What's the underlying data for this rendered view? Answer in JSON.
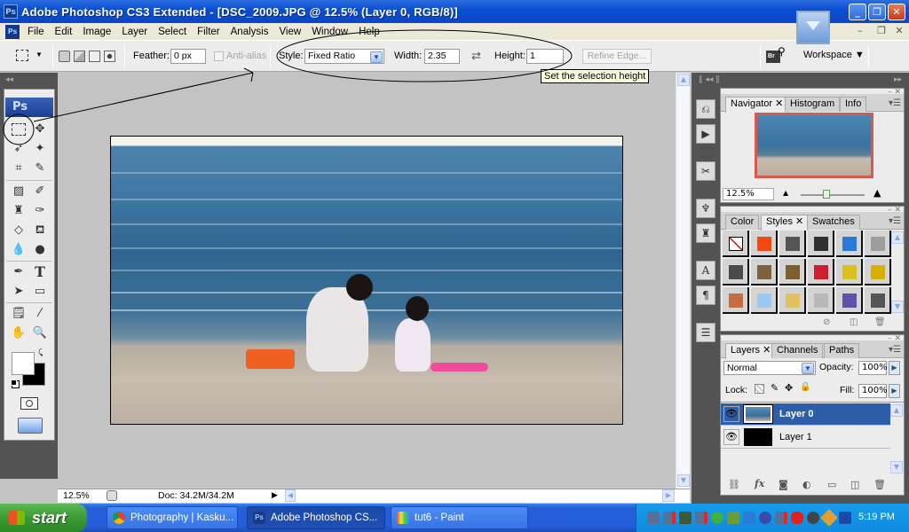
{
  "window": {
    "title": "Adobe Photoshop CS3 Extended - [DSC_2009.JPG @ 12.5% (Layer 0, RGB/8)]",
    "app_icon": "Ps",
    "controls": {
      "minimize": "_",
      "maximize": "❐",
      "close": "✕"
    },
    "doc_controls": {
      "minimize": "–",
      "restore": "❐",
      "close": "✕"
    }
  },
  "menu": [
    "File",
    "Edit",
    "Image",
    "Layer",
    "Select",
    "Filter",
    "Analysis",
    "View",
    "Window",
    "Help"
  ],
  "options": {
    "feather_label": "Feather:",
    "feather_value": "0 px",
    "antialias_label": "Anti-alias",
    "style_label": "Style:",
    "style_value": "Fixed Ratio",
    "width_label": "Width:",
    "width_value": "2.35",
    "height_label": "Height:",
    "height_value": "1",
    "refine_edge": "Refine Edge...",
    "workspace": "Workspace ▼",
    "bridge_icon": "Br",
    "tooltip": "Set the selection height"
  },
  "toolbox": {
    "logo": "Ps"
  },
  "status": {
    "zoom": "12.5%",
    "doc": "Doc: 34.2M/34.2M"
  },
  "navigator": {
    "tabs": [
      "Navigator",
      "Histogram",
      "Info"
    ],
    "zoom_value": "12.5%",
    "zoom_slider_fraction": 0.4
  },
  "styles_panel": {
    "tabs": [
      "Color",
      "Styles",
      "Swatches"
    ],
    "swatch_colors": [
      "none",
      "#f04a10",
      "#555555",
      "#303030",
      "#2a78d8",
      "#9e9e9e",
      "#4a4a4a",
      "#7a6440",
      "#7a6030",
      "#cc2030",
      "#d8c020",
      "#d4b000",
      "#c07040",
      "#9cc8f0",
      "#e0c060",
      "#b8b8b8",
      "#6050a8",
      "#555555"
    ]
  },
  "layers_panel": {
    "tabs": [
      "Layers",
      "Channels",
      "Paths"
    ],
    "blend_mode": "Normal",
    "opacity_label": "Opacity:",
    "opacity_value": "100%",
    "lock_label": "Lock:",
    "fill_label": "Fill:",
    "fill_value": "100%",
    "layers": [
      {
        "name": "Layer 0",
        "selected": true
      },
      {
        "name": "Layer 1",
        "selected": false
      }
    ]
  },
  "taskbar": {
    "start": "start",
    "tasks": [
      {
        "label": "Photography | Kasku...",
        "active": false
      },
      {
        "label": "Adobe Photoshop CS...",
        "active": true
      },
      {
        "label": "tut6 - Paint",
        "active": false
      }
    ],
    "clock": "5:19 PM"
  },
  "colors": {
    "accent": "#2b5bb0",
    "selected_layer": "#2f5ea8",
    "title_bar": "#0c4fd3"
  }
}
